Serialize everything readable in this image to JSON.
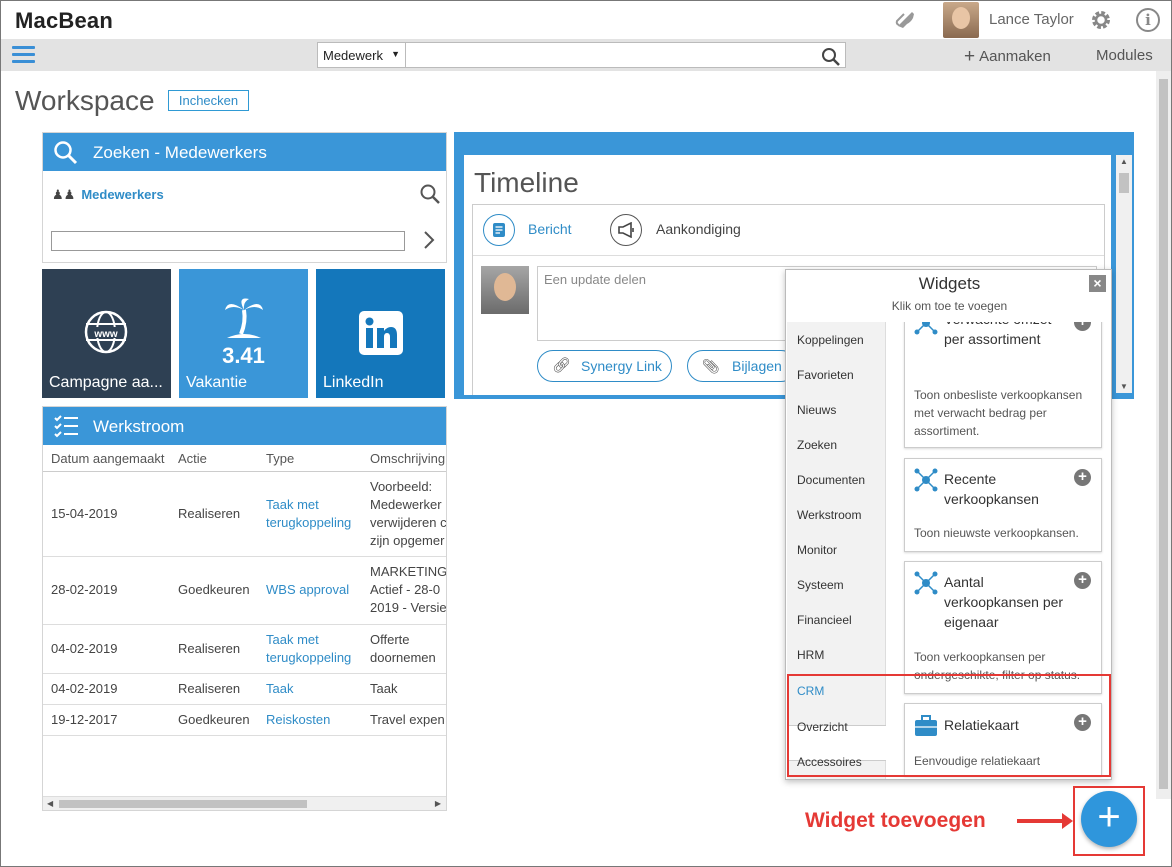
{
  "app": {
    "logo": "MacBean"
  },
  "user": {
    "name": "Lance Taylor"
  },
  "nav": {
    "search_scope": "Medewerk",
    "search_placeholder": "",
    "create_label": "Aanmaken",
    "modules_label": "Modules"
  },
  "workspace": {
    "title": "Workspace",
    "checkin_label": "Inchecken"
  },
  "search_card": {
    "title": "Zoeken - Medewerkers",
    "label": "Medewerkers",
    "input_value": ""
  },
  "tiles": [
    {
      "label": "Campagne aa...",
      "value": ""
    },
    {
      "label": "Vakantie",
      "value": "3.41"
    },
    {
      "label": "LinkedIn",
      "value": ""
    }
  ],
  "werkstroom": {
    "title": "Werkstroom",
    "columns": [
      "Datum aangemaakt",
      "Actie",
      "Type",
      "Omschrijving"
    ],
    "rows": [
      {
        "date": "15-04-2019",
        "action": "Realiseren",
        "type": "Taak met terugkoppeling",
        "desc": "Voorbeeld: Medewerker verwijderen c zijn opgemer"
      },
      {
        "date": "28-02-2019",
        "action": "Goedkeuren",
        "type": "WBS approval",
        "desc": "MARKETING. - Actief - 28-0 2019 - Versie"
      },
      {
        "date": "04-02-2019",
        "action": "Realiseren",
        "type": "Taak met terugkoppeling",
        "desc": "Offerte doornemen"
      },
      {
        "date": "04-02-2019",
        "action": "Realiseren",
        "type": "Taak",
        "desc": "Taak"
      },
      {
        "date": "19-12-2017",
        "action": "Goedkeuren",
        "type": "Reiskosten",
        "desc": "Travel expen"
      }
    ]
  },
  "timeline": {
    "title": "Timeline",
    "tab_message": "Bericht",
    "tab_announcement": "Aankondiging",
    "update_placeholder": "Een update delen",
    "synergy_link": "Synergy Link",
    "attachments": "Bijlagen"
  },
  "widgets_panel": {
    "title": "Widgets",
    "subtitle": "Klik om toe te voegen",
    "categories": [
      "Koppelingen",
      "Favorieten",
      "Nieuws",
      "Zoeken",
      "Documenten",
      "Werkstroom",
      "Monitor",
      "Systeem",
      "Financieel",
      "HRM",
      "CRM",
      "Overzicht",
      "Accessoires"
    ],
    "active_category": "CRM",
    "cards": [
      {
        "title": "Verwachte omzet per assortiment",
        "desc": "Toon onbesliste verkoopkansen met verwacht bedrag per assortiment."
      },
      {
        "title": "Recente verkoopkansen",
        "desc": "Toon nieuwste verkoopkansen."
      },
      {
        "title": "Aantal verkoopkansen per eigenaar",
        "desc": "Toon verkoopkansen per ondergeschikte, filter op status."
      },
      {
        "title": "Relatiekaart",
        "desc": "Eenvoudige relatiekaart"
      }
    ]
  },
  "annotation": {
    "text": "Widget toevoegen"
  },
  "colors": {
    "accent": "#3a96d8",
    "annotation": "#e53935",
    "tile_dark": "#2e4053",
    "tile_linkedin": "#1477bb"
  }
}
